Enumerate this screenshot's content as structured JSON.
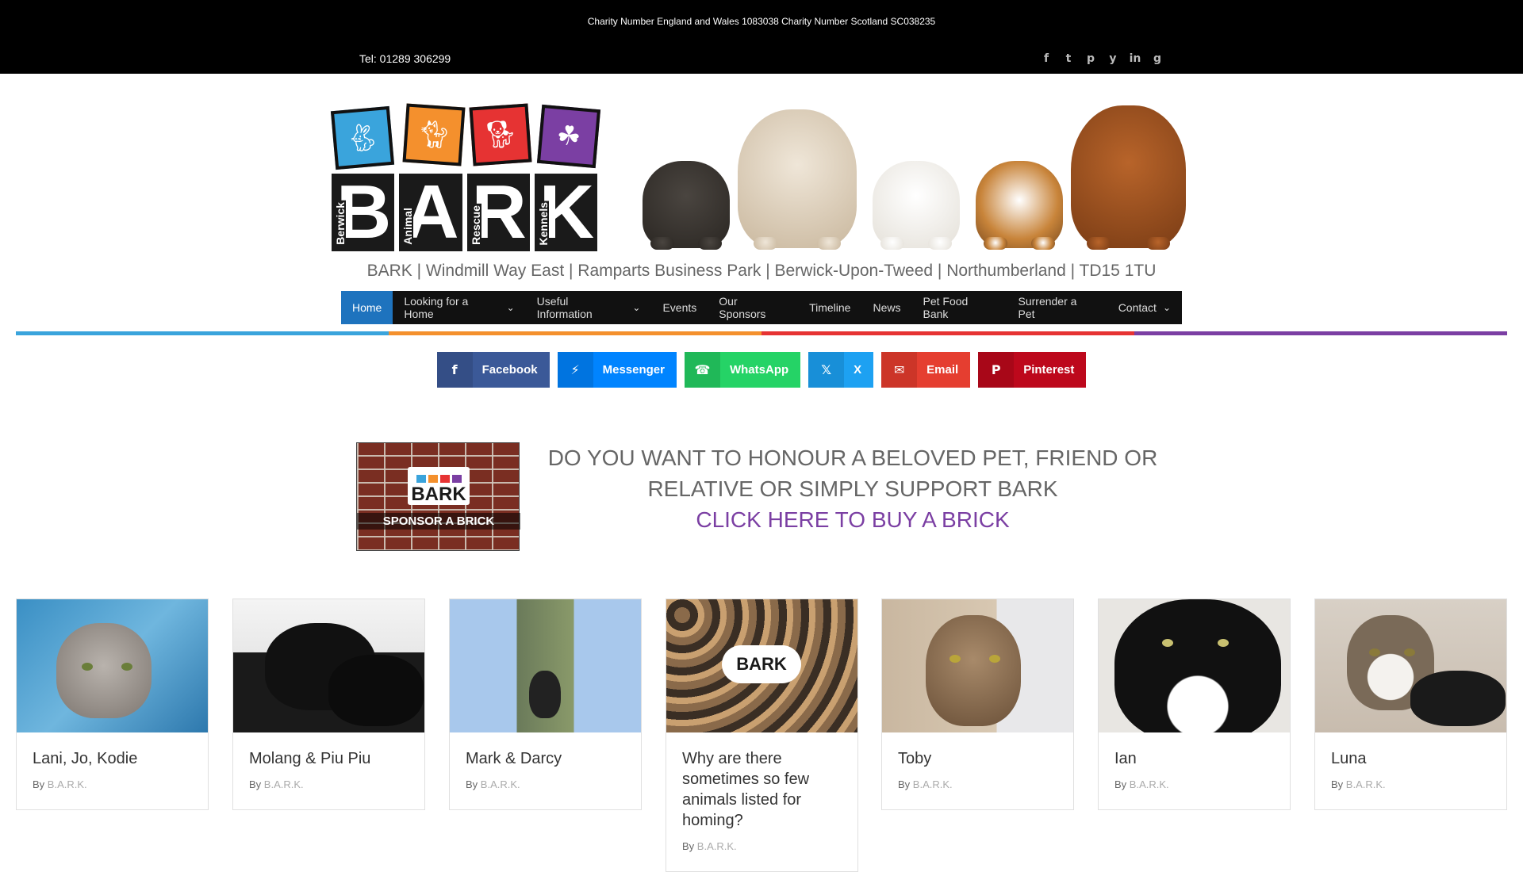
{
  "topbar": {
    "charity": "Charity Number England and Wales 1083038 Charity Number Scotland SC038235",
    "tel": "Tel: 01289 306299",
    "social_icons": [
      "facebook-icon",
      "twitter-icon",
      "pinterest-icon",
      "yelp-icon",
      "linkedin-icon",
      "google-plus-icon"
    ]
  },
  "logo": {
    "word": "BARK",
    "letters": [
      "B",
      "A",
      "R",
      "K"
    ],
    "sub": [
      "Berwick",
      "Animal",
      "Rescue",
      "Kennels"
    ],
    "colors": [
      "#3aa4dc",
      "#f4902d",
      "#e63333",
      "#7b3fa3"
    ]
  },
  "address": "BARK | Windmill Way East | Ramparts Business Park | Berwick-Upon-Tweed | Northumberland | TD15 1TU",
  "nav": {
    "items": [
      {
        "label": "Home",
        "active": true,
        "dropdown": false
      },
      {
        "label": "Looking for a Home",
        "active": false,
        "dropdown": true
      },
      {
        "label": "Useful Information",
        "active": false,
        "dropdown": true
      },
      {
        "label": "Events",
        "active": false,
        "dropdown": false
      },
      {
        "label": "Our Sponsors",
        "active": false,
        "dropdown": false
      },
      {
        "label": "Timeline",
        "active": false,
        "dropdown": false
      },
      {
        "label": "News",
        "active": false,
        "dropdown": false
      },
      {
        "label": "Pet Food Bank",
        "active": false,
        "dropdown": false
      },
      {
        "label": "Surrender a Pet",
        "active": false,
        "dropdown": false
      },
      {
        "label": "Contact",
        "active": false,
        "dropdown": true
      }
    ]
  },
  "share": {
    "buttons": [
      {
        "label": "Facebook",
        "icon": "facebook-icon",
        "color": "#3b5998",
        "icon_color": "#344e86"
      },
      {
        "label": "Messenger",
        "icon": "messenger-icon",
        "color": "#0084ff",
        "icon_color": "#0074e0"
      },
      {
        "label": "WhatsApp",
        "icon": "whatsapp-icon",
        "color": "#25d366",
        "icon_color": "#20b858"
      },
      {
        "label": "X",
        "icon": "x-icon",
        "color": "#1da1f2",
        "icon_color": "#188fd8"
      },
      {
        "label": "Email",
        "icon": "email-icon",
        "color": "#e53e30",
        "icon_color": "#cc3528"
      },
      {
        "label": "Pinterest",
        "icon": "pinterest-icon",
        "color": "#bd081c",
        "icon_color": "#a80718"
      }
    ]
  },
  "brick": {
    "logo_text": "BARK",
    "caption": "SPONSOR A BRICK"
  },
  "promo": {
    "line1": "DO YOU WANT TO  HONOUR A BELOVED PET, FRIEND OR",
    "line2": "RELATIVE OR SIMPLY SUPPORT BARK",
    "cta": "CLICK HERE TO BUY A BRICK"
  },
  "cards": [
    {
      "title": "Lani, Jo, Kodie",
      "by": "By",
      "author": "B.A.R.K."
    },
    {
      "title": "Molang & Piu Piu",
      "by": "By",
      "author": "B.A.R.K."
    },
    {
      "title": "Mark & Darcy",
      "by": "By",
      "author": "B.A.R.K."
    },
    {
      "title": "Why are there sometimes so few animals listed for homing?",
      "by": "By",
      "author": "B.A.R.K."
    },
    {
      "title": "Toby",
      "by": "By",
      "author": "B.A.R.K."
    },
    {
      "title": "Ian",
      "by": "By",
      "author": "B.A.R.K."
    },
    {
      "title": "Luna",
      "by": "By",
      "author": "B.A.R.K."
    }
  ]
}
